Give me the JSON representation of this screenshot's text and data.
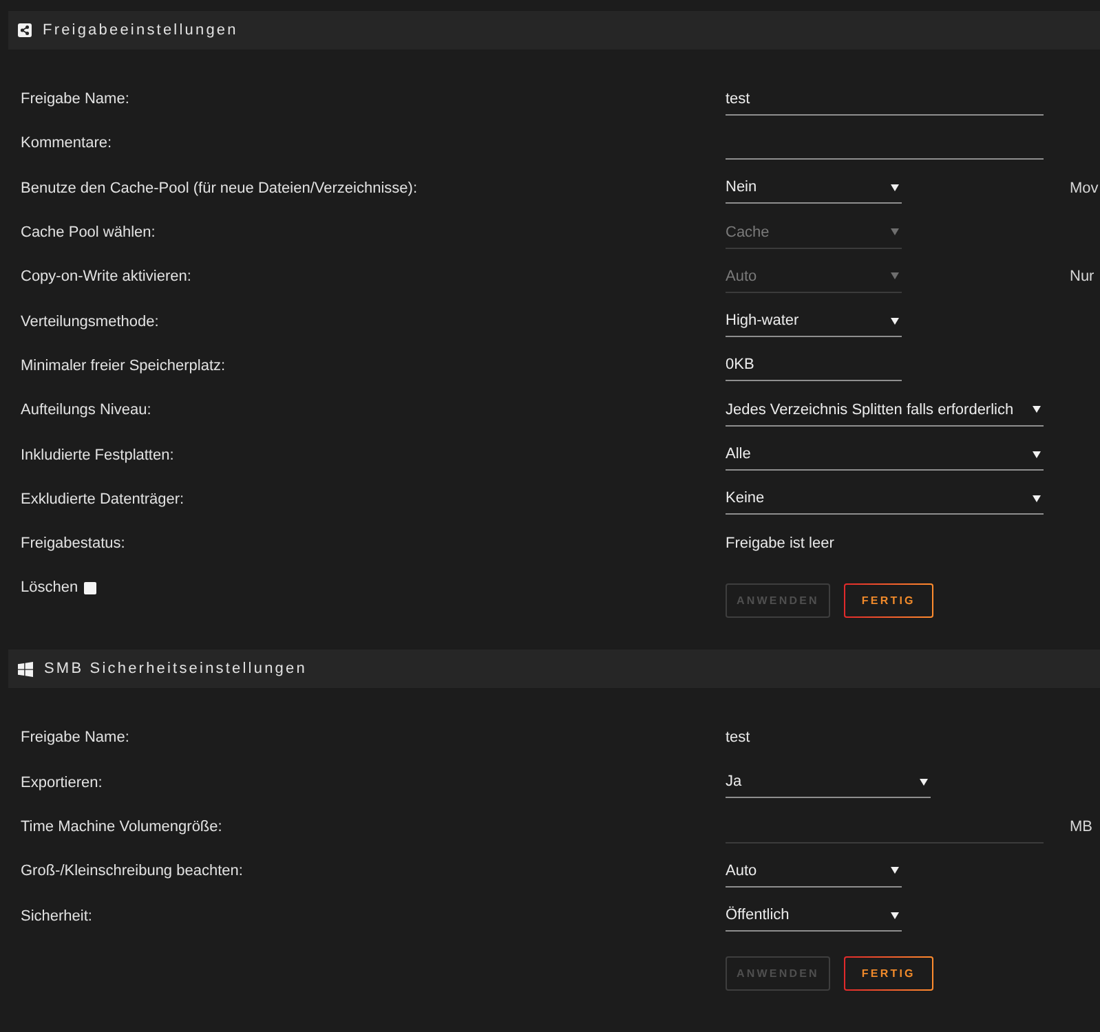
{
  "sections": [
    {
      "title": "Freigabeeinstellungen",
      "rows": [
        {
          "kind": "input",
          "label": "Freigabe Name:",
          "value": "test",
          "disabled": false
        },
        {
          "kind": "input",
          "label": "Kommentare:",
          "disabled": false
        },
        {
          "kind": "select",
          "label": "Benutze den Cache-Pool (für neue Dateien/Verzeichnisse):",
          "value": "Nein",
          "disabled": false,
          "note": "Mov"
        },
        {
          "kind": "select",
          "label": "Cache Pool wählen:",
          "value": "Cache",
          "disabled": true
        },
        {
          "kind": "select",
          "label": "Copy-on-Write aktivieren:",
          "value": "Auto",
          "disabled": true,
          "note": "Nur"
        },
        {
          "kind": "select",
          "label": "Verteilungsmethode:",
          "value": "High-water",
          "disabled": false
        },
        {
          "kind": "input",
          "label": "Minimaler freier Speicherplatz:",
          "value": "0KB",
          "disabled": false
        },
        {
          "kind": "select",
          "label": "Aufteilungs Niveau:",
          "value": "Jedes Verzeichnis Splitten falls erforderlich",
          "disabled": false
        },
        {
          "kind": "select",
          "label": "Inkludierte Festplatten:",
          "value": "Alle",
          "disabled": false
        },
        {
          "kind": "select",
          "label": "Exkludierte Datenträger:",
          "value": "Keine",
          "disabled": false
        },
        {
          "kind": "text",
          "label": "Freigabestatus:",
          "value": "Freigabe ist leer",
          "disabled": false
        }
      ],
      "delete": {
        "label": "Löschen",
        "checked": false
      },
      "buttons": [
        {
          "label": "ANWENDEN",
          "disabled": true
        },
        {
          "label": "FERTIG",
          "disabled": false
        }
      ]
    },
    {
      "title": "SMB Sicherheitseinstellungen",
      "rows": [
        {
          "kind": "text",
          "label": "Freigabe Name:",
          "value": "test",
          "disabled": false
        },
        {
          "kind": "select",
          "label": "Exportieren:",
          "value": "Ja",
          "disabled": false
        },
        {
          "kind": "input",
          "label": "Time Machine Volumengröße:",
          "disabled": true,
          "note": "MB"
        },
        {
          "kind": "select",
          "label": "Groß-/Kleinschreibung beachten:",
          "value": "Auto",
          "disabled": false
        },
        {
          "kind": "select",
          "label": "Sicherheit:",
          "value": "Öffentlich",
          "disabled": false
        }
      ],
      "buttons": [
        {
          "label": "ANWENDEN",
          "disabled": true
        },
        {
          "label": "FERTIG",
          "disabled": false
        }
      ]
    }
  ]
}
